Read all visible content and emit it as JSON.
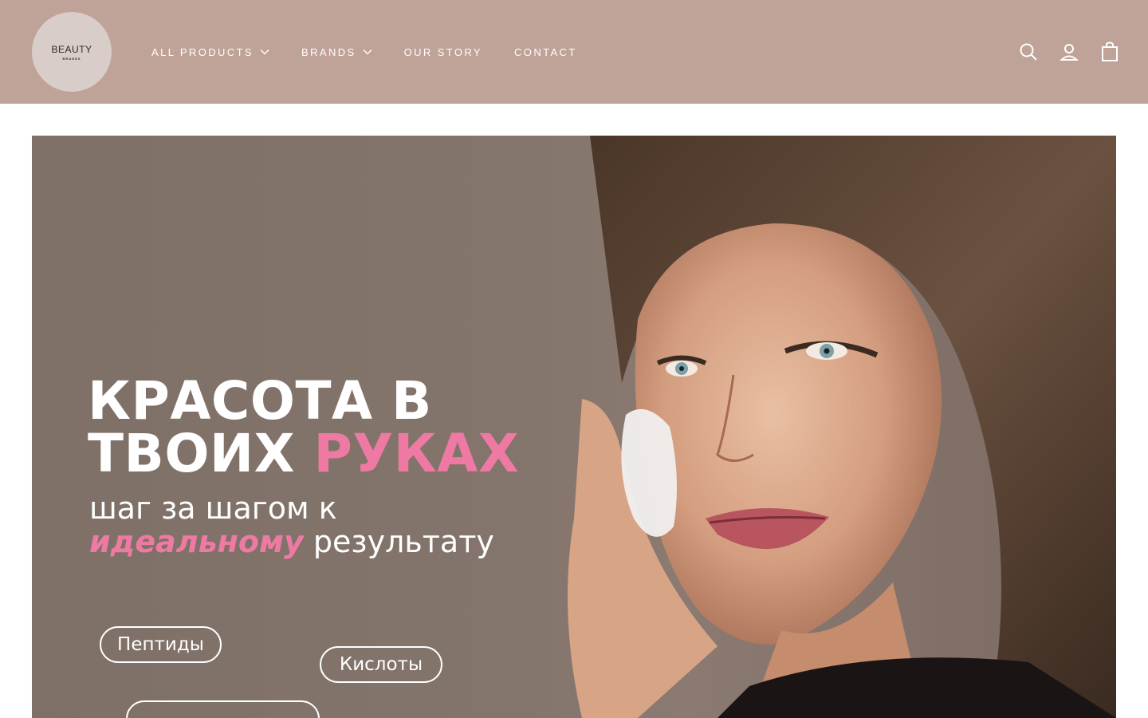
{
  "header": {
    "logo": {
      "main": "BEAUTY",
      "sub": "BRANDS"
    },
    "nav": [
      {
        "label": "ALL PRODUCTS",
        "has_dropdown": true
      },
      {
        "label": "BRANDS",
        "has_dropdown": true
      },
      {
        "label": "OUR STORY",
        "has_dropdown": false
      },
      {
        "label": "CONTACT",
        "has_dropdown": false
      }
    ],
    "icons": [
      "search-icon",
      "account-icon",
      "cart-icon"
    ],
    "background_color": "#bfa298"
  },
  "hero": {
    "headline_line1": "КРАСОТА В",
    "headline_line2_white": "ТВОИХ",
    "headline_line2_pink": "РУКАХ",
    "subline_line1": "шаг за шагом к",
    "subline_em": "идеальному",
    "subline_rest": "результату",
    "pills": [
      "Пептиды",
      "Кислоты"
    ],
    "accent_color": "#ee7aa3"
  }
}
